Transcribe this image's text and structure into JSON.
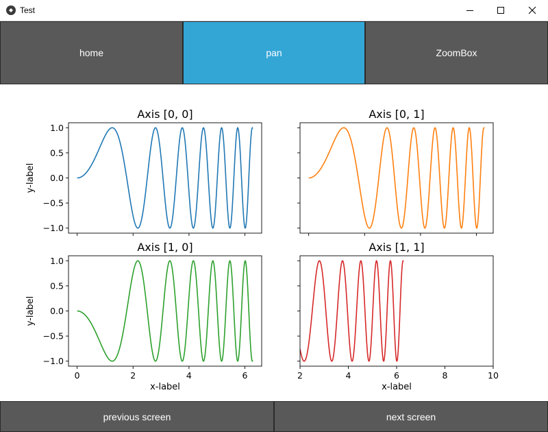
{
  "window": {
    "title": "Test"
  },
  "toolbar": {
    "buttons": [
      {
        "label": "home"
      },
      {
        "label": "pan"
      },
      {
        "label": "ZoomBox"
      }
    ],
    "active": "pan"
  },
  "footer": {
    "prev_label": "previous screen",
    "next_label": "next screen"
  },
  "colors": {
    "button_bg": "#595959",
    "button_active": "#33a6d6",
    "series": [
      "#1f77b4",
      "#ff7f0e",
      "#2ca02c",
      "#d62728"
    ]
  },
  "chart_data": [
    {
      "type": "line",
      "title": "Axis [0, 0]",
      "xlabel": "",
      "ylabel": "y-label",
      "function": "sin(x^2)",
      "x_range": [
        0,
        6.28
      ],
      "xlim": [
        -0.31,
        6.6
      ],
      "ylim": [
        -1.1,
        1.1
      ],
      "xticks": [
        0,
        2,
        4,
        6
      ],
      "xtick_labels": [],
      "yticks": [
        1.0,
        0.5,
        0.0,
        -0.5,
        -1.0
      ],
      "ytick_labels": [
        "1.0",
        "0.5",
        "0.0",
        "−0.5",
        "−1.0"
      ],
      "color": "#1f77b4"
    },
    {
      "type": "line",
      "title": "Axis [0, 1]",
      "xlabel": "",
      "ylabel": "",
      "function": "sin(x^2)",
      "x_range": [
        0,
        6.28
      ],
      "xlim": [
        -0.31,
        6.6
      ],
      "ylim": [
        -1.1,
        1.1
      ],
      "xticks": [
        0,
        2,
        4,
        6
      ],
      "xtick_labels": [],
      "yticks": [
        1.0,
        0.5,
        0.0,
        -0.5,
        -1.0
      ],
      "ytick_labels": [],
      "color": "#ff7f0e"
    },
    {
      "type": "line",
      "title": "Axis [1, 0]",
      "xlabel": "x-label",
      "ylabel": "y-label",
      "function": "-sin(x^2)",
      "x_range": [
        0,
        6.28
      ],
      "xlim": [
        -0.31,
        6.6
      ],
      "ylim": [
        -1.1,
        1.1
      ],
      "xticks": [
        0,
        2,
        4,
        6
      ],
      "xtick_labels": [
        "0",
        "2",
        "4",
        "6"
      ],
      "yticks": [
        1.0,
        0.5,
        0.0,
        -0.5,
        -1.0
      ],
      "ytick_labels": [
        "1.0",
        "0.5",
        "0.0",
        "−0.5",
        "−1.0"
      ],
      "color": "#2ca02c"
    },
    {
      "type": "line",
      "title": "Axis [1, 1]",
      "xlabel": "x-label",
      "ylabel": "",
      "function": "sin(x^2)",
      "x_range": [
        2,
        6.28
      ],
      "xlim": [
        2,
        10
      ],
      "ylim": [
        -1.1,
        1.1
      ],
      "xticks": [
        2,
        4,
        6,
        8,
        10
      ],
      "xtick_labels": [
        "2",
        "4",
        "6",
        "8",
        "10"
      ],
      "yticks": [
        1.0,
        0.5,
        0.0,
        -0.5,
        -1.0
      ],
      "ytick_labels": [],
      "color": "#d62728"
    }
  ]
}
